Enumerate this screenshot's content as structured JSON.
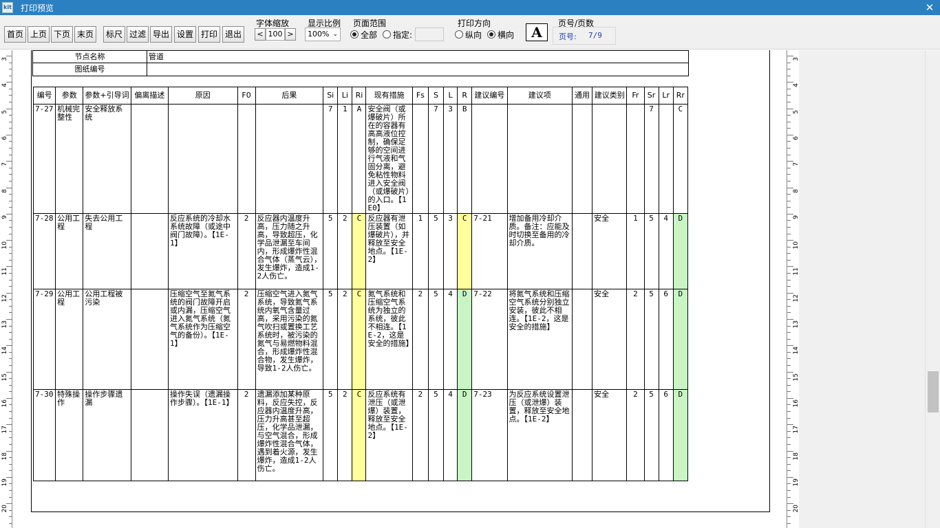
{
  "window": {
    "logo": "kit",
    "title": "打印预览",
    "close_label": "✕"
  },
  "toolbar": {
    "buttons": [
      "首页",
      "上页",
      "下页",
      "末页",
      "标尺",
      "过滤",
      "导出",
      "设置",
      "打印",
      "退出"
    ],
    "font_scale": {
      "label": "字体缩放",
      "value": "100",
      "dec": "<",
      "inc": ">"
    },
    "zoom": {
      "label": "显示比例",
      "value": "100%"
    },
    "page_range": {
      "label": "页面范围",
      "all": "全部",
      "specify": "指定:"
    },
    "orientation": {
      "label": "打印方向",
      "portrait": "纵向",
      "landscape": "横向"
    },
    "font_icon": "A",
    "page_no": {
      "label": "页号/页数",
      "prefix": "页号:",
      "value": "7/9"
    }
  },
  "ruler_left": [
    "3",
    "4",
    "5",
    "6",
    "7",
    "8",
    "9",
    "10",
    "11",
    "12",
    "13",
    "14",
    "15",
    "16",
    "17",
    "18",
    "19",
    "20"
  ],
  "ruler_right": [
    "3",
    "4",
    "5",
    "6",
    "7",
    "8",
    "9",
    "10",
    "11",
    "12",
    "13",
    "14",
    "15",
    "16",
    "17",
    "18",
    "19",
    "20"
  ],
  "header_table": {
    "node_label": "节点名称",
    "node_value": "管道",
    "drawing_label": "图纸编号",
    "drawing_value": ""
  },
  "columns": [
    "编号",
    "参数",
    "参数+引导词",
    "偏离描述",
    "原因",
    "F0",
    "后果",
    "Si",
    "Li",
    "Ri",
    "现有措施",
    "Fs",
    "S",
    "L",
    "R",
    "建议编号",
    "建议项",
    "通用",
    "建议类别",
    "Fr",
    "Sr",
    "Lr",
    "Rr"
  ],
  "rows": [
    {
      "id": "7-27",
      "param": "机械完整性",
      "guide": "安全释放系统",
      "dev": "",
      "cause": "",
      "f0": "",
      "cons": "",
      "si": "7",
      "li": "1",
      "ri": "A",
      "measure": "安全阀（或爆破片）所在的容器有高高液位控制，确保足够的空间进行气液和气固分离，避免粘性物料进入安全阀（或爆破片）的入口。【1E0】",
      "fs": "",
      "s": "7",
      "l": "3",
      "r": "B",
      "sid": "",
      "sug": "",
      "gen": "",
      "cat": "",
      "fr": "",
      "sr": "7",
      "lr": "",
      "rr": "C"
    },
    {
      "id": "7-28",
      "param": "公用工程",
      "guide": "失去公用工程",
      "dev": "",
      "cause": "反应系统的冷却水系统故障（或途中阀门故障）。【1E-1】",
      "f0": "2",
      "cons": "反应器内温度升高，压力随之升高，导致超压，化学品泄漏至车间内，形成爆炸性混合气体（蒸气云），发生爆炸，造成1-2人伤亡。",
      "si": "5",
      "li": "2",
      "ri": "C",
      "measure": "反应器有泄压装置（如爆破片），并释放至安全地点。【1E-2】",
      "fs": "1",
      "s": "5",
      "l": "3",
      "r": "C",
      "sid": "7-21",
      "sug": "增加备用冷却介质。备注：应能及时切换至备用的冷却介质。",
      "gen": "",
      "cat": "安全",
      "fr": "1",
      "sr": "5",
      "lr": "4",
      "rr": "D"
    },
    {
      "id": "7-29",
      "param": "公用工程",
      "guide": "公用工程被污染",
      "dev": "",
      "cause": "压缩空气至氮气系统的阀门故障开启或内漏，压缩空气进入氮气系统（氮气系统作为压缩空气的备份）。【1E-1】",
      "f0": "2",
      "cons": "压缩空气进入氮气系统，导致氮气系统内氧气含量过高，采用污染的氮气吹扫或置换工艺系统时，被污染的氮气与易燃物料混合，形成爆炸性混合物，发生爆炸，导致1-2人伤亡。",
      "si": "5",
      "li": "2",
      "ri": "C",
      "measure": "氮气系统和压缩空气系统为独立的系统，彼此不相连。【1E-2，这是安全的措施】",
      "fs": "2",
      "s": "5",
      "l": "4",
      "r": "D",
      "sid": "7-22",
      "sug": "将氮气系统和压缩空气系统分别独立安装，彼此不相连。【1E-2，这是安全的措施】",
      "gen": "",
      "cat": "安全",
      "fr": "2",
      "sr": "5",
      "lr": "6",
      "rr": "D"
    },
    {
      "id": "7-30",
      "param": "特殊操作",
      "guide": "操作步骤遗漏",
      "dev": "",
      "cause": "操作失误（遗漏操作步骤）。【1E-1】",
      "f0": "2",
      "cons": "遗漏添加某种原料，反应失控，反应器内温度升高，压力升高甚至超压，化学品泄漏，与空气混合，形成爆炸性混合气体，遇到着火源，发生爆炸，造成1-2人伤亡。",
      "si": "5",
      "li": "2",
      "ri": "C",
      "measure": "反应系统有泄压（或泄爆）装置，释放至安全地点。【1E-2】",
      "fs": "2",
      "s": "5",
      "l": "4",
      "r": "D",
      "sid": "7-23",
      "sug": "为反应系统设置泄压（或泄爆）装置，释放至安全地点。【1E-2】",
      "gen": "",
      "cat": "安全",
      "fr": "2",
      "sr": "5",
      "lr": "6",
      "rr": "D"
    }
  ]
}
